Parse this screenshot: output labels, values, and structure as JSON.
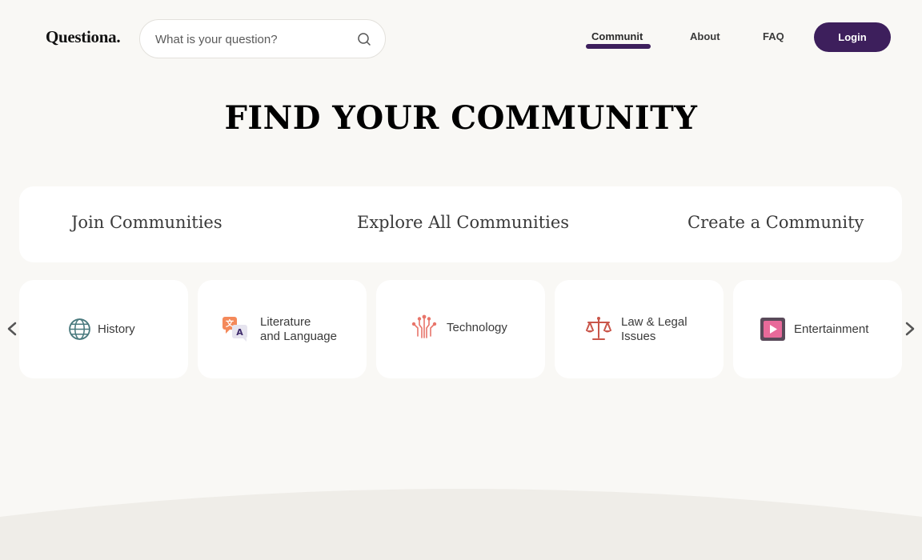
{
  "header": {
    "logo": "Questiona.",
    "search_placeholder": "What is your question?",
    "nav": {
      "community": "Communit",
      "about": "About",
      "faq": "FAQ"
    },
    "login": "Login"
  },
  "main": {
    "title": "FIND YOUR COMMUNITY",
    "actions": {
      "join": "Join Communities",
      "explore": "Explore All Communities",
      "create": "Create a Community"
    },
    "categories": [
      {
        "label": "History",
        "icon": "globe-icon"
      },
      {
        "label": "Literature\nand Language",
        "icon": "translate-icon"
      },
      {
        "label": "Technology",
        "icon": "circuit-icon"
      },
      {
        "label": "Law & Legal\nIssues",
        "icon": "scales-icon"
      },
      {
        "label": "Entertainment",
        "icon": "play-icon"
      }
    ]
  },
  "colors": {
    "background": "#f9f8f5",
    "accent": "#3d1f5c",
    "card": "#ffffff"
  }
}
